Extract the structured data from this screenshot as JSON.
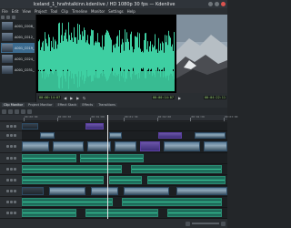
{
  "window": {
    "title": "Iceland_1_hrafntalkinn.kdenlive / HD 1080p 30 fps — Kdenlive"
  },
  "menu": [
    "File",
    "Edit",
    "View",
    "Project",
    "Tool",
    "Clip",
    "Timeline",
    "Monitor",
    "Settings",
    "Help"
  ],
  "bin": {
    "clips": [
      {
        "label": "A001_C008_1",
        "selected": false
      },
      {
        "label": "A001_C012_1",
        "selected": false
      },
      {
        "label": "A001_C019_1",
        "selected": true
      },
      {
        "label": "A001_C024_1",
        "selected": false
      },
      {
        "label": "A001_C031_1",
        "selected": false
      }
    ]
  },
  "clip_monitor": {
    "timecode": "00:00:14:07",
    "marker": "00:00:14:07",
    "controls": [
      "prev",
      "play",
      "next",
      "loop",
      "zoom"
    ]
  },
  "project_monitor": {
    "timecode": "00:04:22:11"
  },
  "tabs": [
    {
      "label": "Clip Monitor",
      "active": true
    },
    {
      "label": "Project Monitor",
      "active": false
    },
    {
      "label": "Effect Stack",
      "active": false
    },
    {
      "label": "Effects",
      "active": false
    },
    {
      "label": "Transitions",
      "active": false
    }
  ],
  "ruler": {
    "labels": [
      "00:00:00",
      "00:00:30",
      "00:01:00",
      "00:01:30",
      "00:02:00",
      "00:02:30",
      "00:03:00"
    ]
  },
  "statusbar": {
    "zoom": "Zoom"
  }
}
